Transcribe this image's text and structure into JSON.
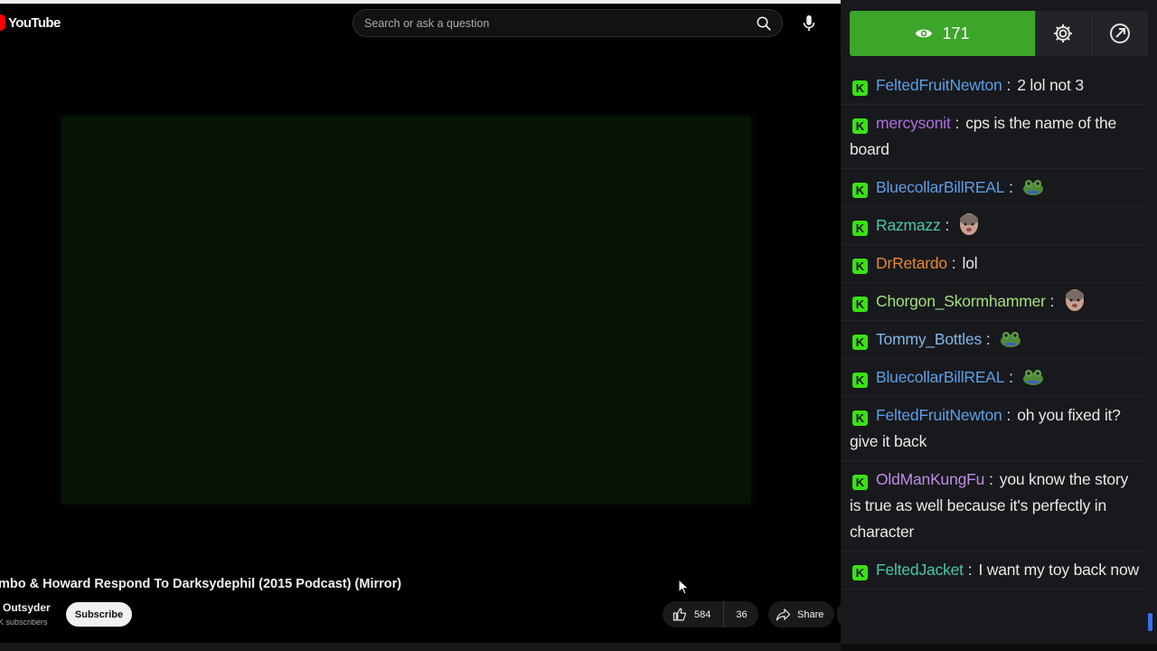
{
  "youtube": {
    "logo_text": "YouTube",
    "search_placeholder": "Search or ask a question",
    "video_title": "mbo & Howard Respond To Darksydephil (2015 Podcast) (Mirror)",
    "channel_name": "Outsyder",
    "channel_subscribers": "K subscribers",
    "subscribe_label": "Subscribe",
    "like_count": "584",
    "dislike_count": "36",
    "share_label": "Share"
  },
  "chat": {
    "viewer_count": "171",
    "messages": [
      {
        "user": "FeltedFruitNewton",
        "color": "#5c9ee6",
        "text": "2 lol not 3",
        "emote": null
      },
      {
        "user": "mercysonit",
        "color": "#b06ee0",
        "text": "cps is the name of the board",
        "emote": null
      },
      {
        "user": "BluecollarBillREAL",
        "color": "#5c9ee6",
        "text": "",
        "emote": "frog-emote"
      },
      {
        "user": "Razmazz",
        "color": "#46c9a6",
        "text": "",
        "emote": "face-emote"
      },
      {
        "user": "DrRetardo",
        "color": "#e68a2e",
        "text": "lol",
        "emote": null
      },
      {
        "user": "Chorgon_Skormhammer",
        "color": "#a3e07a",
        "text": "",
        "emote": "face-emote"
      },
      {
        "user": "Tommy_Bottles",
        "color": "#7fb6ea",
        "text": "",
        "emote": "frog-emote"
      },
      {
        "user": "BluecollarBillREAL",
        "color": "#5c9ee6",
        "text": "",
        "emote": "frog-emote"
      },
      {
        "user": "FeltedFruitNewton",
        "color": "#5c9ee6",
        "text": "oh you fixed it? give it back",
        "emote": null
      },
      {
        "user": "OldManKungFu",
        "color": "#c28ae8",
        "text": "you know the story is true as well because it's perfectly in character",
        "emote": null
      },
      {
        "user": "FeltedJacket",
        "color": "#46c9a6",
        "text": "I want my toy back now",
        "emote": null
      }
    ]
  },
  "colors": {
    "viewer_green": "#3ca62a",
    "kick_badge": "#3ae016",
    "chat_bg": "#18191c"
  },
  "icons": [
    "search-icon",
    "mic-icon",
    "eye-icon",
    "gear-icon",
    "popout-icon",
    "thumbs-up-icon",
    "thumbs-down-icon",
    "share-icon",
    "kick-badge-icon",
    "cursor-icon"
  ]
}
